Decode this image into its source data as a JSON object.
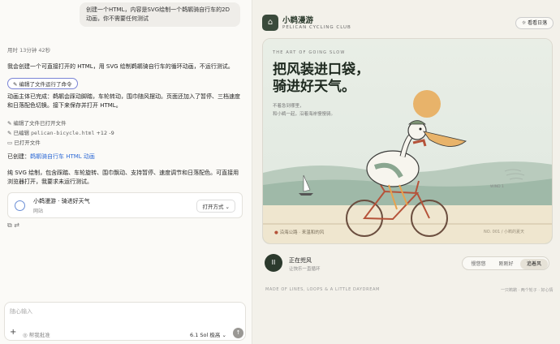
{
  "chat": {
    "user_message": "创建一个HTML，内容是SVG绘制一个鹈鹕骑自行车的2D动画，你不需要任何测试",
    "elapsed": "用时 13分钟 42秒",
    "intro": "我会创建一个可直接打开的 HTML，用 SVG 绘制鹈鹕骑自行车的循环动画，不运行测试。",
    "run_command_pill": "编辑了文件运行了命令",
    "summary": "动画主体已完成：鹈鹕会踩动脚踏，车轮转动，围巾随风摆动。页面还加入了暂停、三档速度和日落配色切换。接下来保存并打开 HTML。",
    "actions": [
      {
        "icon": "edit-icon",
        "label": "编辑了文件已打开文件"
      },
      {
        "icon": "edit-icon",
        "label": "已编辑",
        "file": "pelican-bicycle.html",
        "diff": "+12 -9"
      },
      {
        "icon": "file-icon",
        "label": "已打开文件"
      }
    ],
    "created_prefix": "已创建：",
    "created_link": "鹈鹕骑自行车 HTML 动画",
    "final_text": "纯 SVG 绘制，包含踩踏、车轮旋转、围巾飘动、支持暂停、速度调节和日落配色。可直接用浏览器打开，我要求未运行测试。",
    "card": {
      "title": "小鹈漫游 · 骑进好天气",
      "subtitle": "网站",
      "open_label": "打开方式"
    },
    "composer": {
      "placeholder": "随心输入",
      "help": "帮我批准",
      "model": "6.1 Sol 极高"
    }
  },
  "app": {
    "logo_glyph": "⌂",
    "brand": "小鹈漫游",
    "brand_en": "PELICAN CYCLING CLUB",
    "daytime_button": "看看日落",
    "kicker": "THE ART OF GOING SLOW",
    "headline_1": "把风装进口袋，",
    "headline_2": "骑进好天气。",
    "sub_1": "不着急到哪里，",
    "sub_2": "和小鹈一起，沿着海岸慢慢骑。",
    "bottom_left": "沿海公路 · 来温和的风",
    "bottom_right": "NO. 001 / 小鹈的夏天",
    "wind_label": "WIND 1",
    "player": {
      "state": "正在兜风",
      "sub": "让快乐一直循环",
      "play_glyph": "II"
    },
    "speeds": [
      {
        "label": "慢悠悠",
        "active": false
      },
      {
        "label": "刚刚好",
        "active": false
      },
      {
        "label": "追着风",
        "active": true
      }
    ],
    "footer": "MADE OF LINES, LOOPS & A LITTLE DAYDREAM",
    "footer_right": "一只鹈鹕 · 两个轮子 · 好心情"
  },
  "colors": {
    "accent": "#2c3a2d",
    "link": "#2f6bd6",
    "sun": "#e8b36a",
    "bike": "#b5533a"
  }
}
